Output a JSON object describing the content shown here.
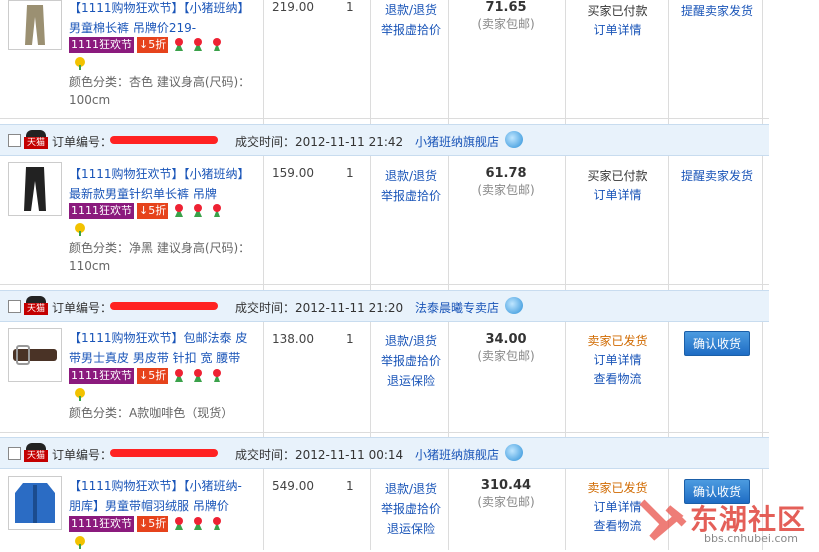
{
  "orders": [
    {
      "item_title": "【1111购物狂欢节】【小猪班纳】男童棉长裤 吊牌价219-",
      "tag_festival": "1111狂欢节",
      "tag_discount": "↓5折",
      "color_info": "颜色分类：杏色  建议身高(尺码)：100cm",
      "price": "219.00",
      "qty": "1",
      "links": [
        "退款/退货",
        "举报虚拾价"
      ],
      "total": "71.65",
      "total_note": "(卖家包邮)",
      "status": "买家已付款",
      "status_links": [
        "订单详情"
      ],
      "action": "提醒卖家发货"
    },
    {
      "order_label": "订单编号：",
      "deal_time_label": "成交时间：",
      "deal_time": "2012-11-11 21:42",
      "shop": "小猪班纳旗舰店",
      "item_title": "【1111购物狂欢节】【小猪班纳】最新款男童针织单长裤 吊牌",
      "tag_festival": "1111狂欢节",
      "tag_discount": "↓5折",
      "color_info": "颜色分类：净黑  建议身高(尺码)：110cm",
      "price": "159.00",
      "qty": "1",
      "links": [
        "退款/退货",
        "举报虚拾价"
      ],
      "total": "61.78",
      "total_note": "(卖家包邮)",
      "status": "买家已付款",
      "status_links": [
        "订单详情"
      ],
      "action": "提醒卖家发货"
    },
    {
      "order_label": "订单编号：",
      "deal_time_label": "成交时间：",
      "deal_time": "2012-11-11 21:20",
      "shop": "法泰晨曦专卖店",
      "item_title": "【1111购物狂欢节】包邮法泰 皮带男士真皮 男皮带 针扣 宽 腰带",
      "tag_festival": "1111狂欢节",
      "tag_discount": "↓5折",
      "color_info": "颜色分类：A款咖啡色（现货）",
      "price": "138.00",
      "qty": "1",
      "links": [
        "退款/退货",
        "举报虚拾价",
        "退运保险"
      ],
      "total": "34.00",
      "total_note": "(卖家包邮)",
      "status": "卖家已发货",
      "status_links": [
        "订单详情",
        "查看物流"
      ],
      "action": "确认收货"
    },
    {
      "order_label": "订单编号：",
      "deal_time_label": "成交时间：",
      "deal_time": "2012-11-11 00:14",
      "shop": "小猪班纳旗舰店",
      "item_title": "【1111购物狂欢节】【小猪班纳-朋库】男童带帽羽绒服 吊牌价",
      "tag_festival": "1111狂欢节",
      "tag_discount": "↓5折",
      "price": "549.00",
      "qty": "1",
      "links": [
        "退款/退货",
        "举报虚拾价",
        "退运保险"
      ],
      "total": "310.44",
      "total_note": "(卖家包邮)",
      "status": "卖家已发货",
      "status_links": [
        "订单详情",
        "查看物流"
      ],
      "action": "确认收货"
    }
  ],
  "tmall_badge": "天猫",
  "watermark": {
    "brand": "东湖社区",
    "url": "bbs.cnhubei.com"
  },
  "colors": {
    "link": "#1a55b8",
    "header_bg": "#e8f2fb",
    "tag_festival": "#8b1a7d",
    "tag_discount": "#e6431c",
    "shipped": "#d06a00"
  }
}
